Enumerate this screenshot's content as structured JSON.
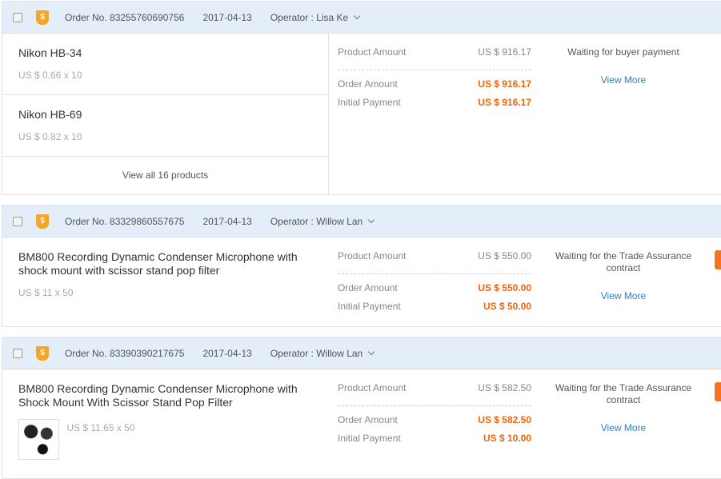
{
  "orders": [
    {
      "order_no": "Order No. 83255760690756",
      "date": "2017-04-13",
      "operator": "Operator : Lisa Ke",
      "products": [
        {
          "name": "Nikon HB-34",
          "price": "US $ 0.66 x 10"
        },
        {
          "name": "Nikon HB-69",
          "price": "US $ 0.82 x 10"
        }
      ],
      "view_all": "View all 16 products",
      "product_amount_label": "Product Amount",
      "product_amount": "US $ 916.17",
      "order_amount_label": "Order Amount",
      "order_amount": "US $ 916.17",
      "initial_payment_label": "Initial Payment",
      "initial_payment": "US $ 916.17",
      "status": "Waiting for buyer payment",
      "view_more": "View More"
    },
    {
      "order_no": "Order No. 83329860557675",
      "date": "2017-04-13",
      "operator": "Operator : Willow Lan",
      "products": [
        {
          "name": "BM800 Recording Dynamic Condenser Microphone with shock mount with scissor stand pop filter",
          "price": "US $ 11 x 50"
        }
      ],
      "product_amount_label": "Product Amount",
      "product_amount": "US $ 550.00",
      "order_amount_label": "Order Amount",
      "order_amount": "US $ 550.00",
      "initial_payment_label": "Initial Payment",
      "initial_payment": "US $ 50.00",
      "status": "Waiting for the Trade Assurance contract",
      "view_more": "View More"
    },
    {
      "order_no": "Order No. 83390390217675",
      "date": "2017-04-13",
      "operator": "Operator : Willow Lan",
      "products": [
        {
          "name": "BM800 Recording Dynamic Condenser Microphone with Shock Mount With Scissor Stand Pop Filter",
          "price": "US $ 11.65 x 50"
        }
      ],
      "product_amount_label": "Product Amount",
      "product_amount": "US $ 582.50",
      "order_amount_label": "Order Amount",
      "order_amount": "US $ 582.50",
      "initial_payment_label": "Initial Payment",
      "initial_payment": "US $ 10.00",
      "status": "Waiting for the Trade Assurance contract",
      "view_more": "View More"
    }
  ]
}
